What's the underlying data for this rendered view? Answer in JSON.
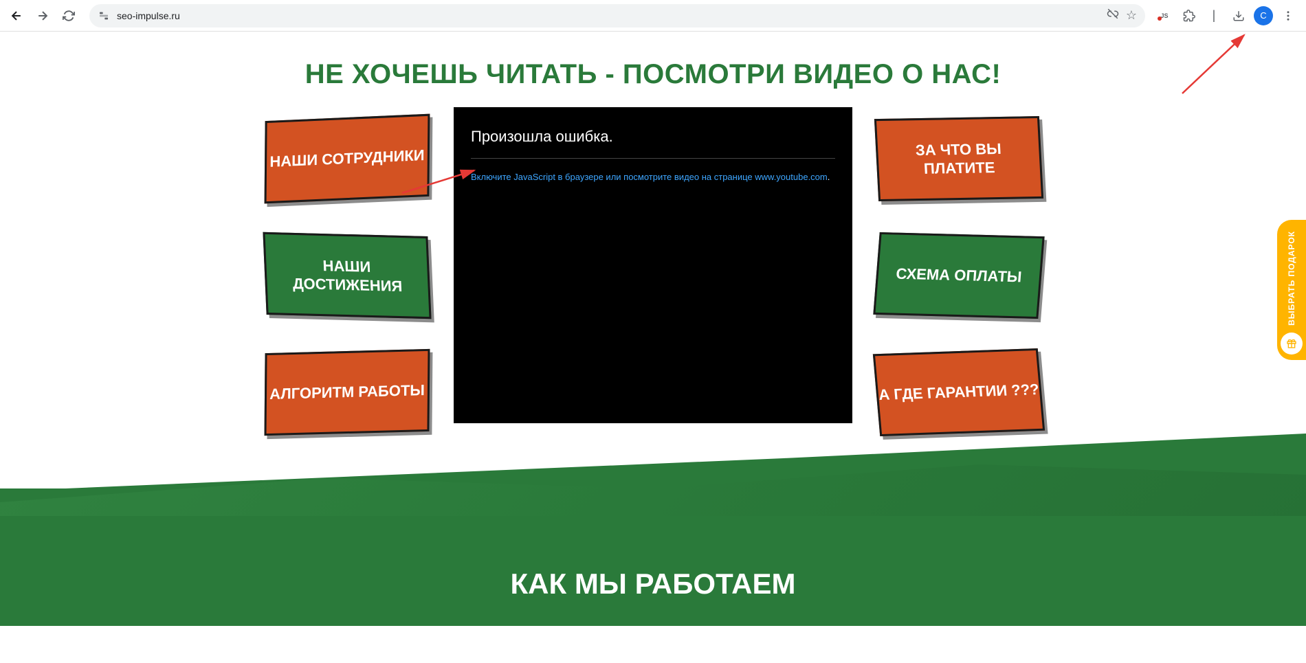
{
  "browser": {
    "url": "seo-impulse.ru",
    "profile_letter": "C"
  },
  "page": {
    "hero_title": "НЕ ХОЧЕШЬ ЧИТАТЬ - ПОСМОТРИ ВИДЕО О НАС!",
    "left_cards": [
      {
        "label": "НАШИ СОТРУДНИКИ",
        "color": "orange"
      },
      {
        "label": "НАШИ ДОСТИЖЕНИЯ",
        "color": "green"
      },
      {
        "label": "АЛГОРИТМ РАБОТЫ",
        "color": "orange"
      }
    ],
    "right_cards": [
      {
        "label": "ЗА ЧТО ВЫ ПЛАТИТЕ",
        "color": "orange"
      },
      {
        "label": "СХЕМА ОПЛАТЫ",
        "color": "green"
      },
      {
        "label": "А ГДЕ ГАРАНТИИ ???",
        "color": "orange"
      }
    ],
    "video": {
      "error_title": "Произошла ошибка.",
      "error_prefix": "Включите JavaScript в браузере или посмотрите видео на странице ",
      "yt_link": "www.youtube.com",
      "dot": "."
    },
    "how_title": "КАК МЫ РАБОТАЕМ",
    "gift_label": "ВЫБРАТЬ ПОДАРОК"
  }
}
